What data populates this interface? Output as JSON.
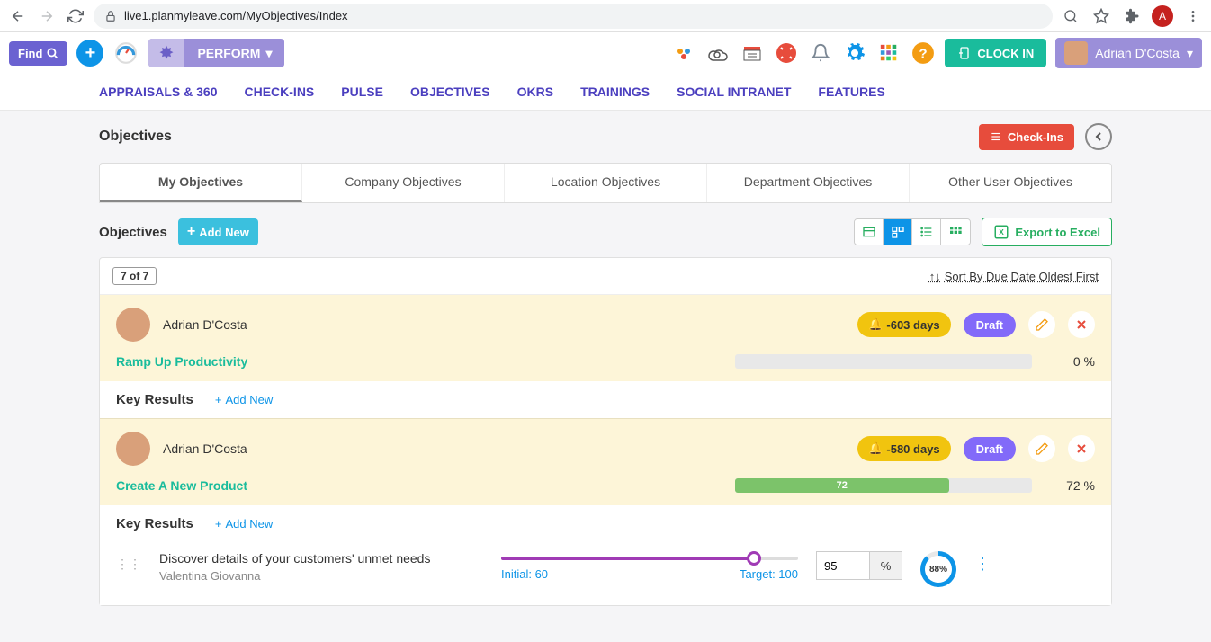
{
  "browser": {
    "url": "live1.planmyleave.com/MyObjectives/Index",
    "avatar_letter": "A"
  },
  "app_bar": {
    "find_label": "Find",
    "perform_label": "PERFORM",
    "clock_in_label": "CLOCK IN",
    "user_name": "Adrian D'Costa"
  },
  "nav": [
    "APPRAISALS & 360",
    "CHECK-INS",
    "PULSE",
    "OBJECTIVES",
    "OKRS",
    "TRAININGS",
    "SOCIAL INTRANET",
    "FEATURES"
  ],
  "page": {
    "title": "Objectives",
    "checkins_btn": "Check-Ins"
  },
  "subtabs": [
    "My Objectives",
    "Company Objectives",
    "Location Objectives",
    "Department Objectives",
    "Other User Objectives"
  ],
  "toolbar": {
    "title": "Objectives",
    "add_new": "Add New",
    "export": "Export to Excel"
  },
  "list": {
    "count": "7 of 7",
    "sort_label": "Sort By Due Date Oldest First"
  },
  "objectives": [
    {
      "user": "Adrian D'Costa",
      "days": "-603 days",
      "status": "Draft",
      "name": "Ramp Up Productivity",
      "progress_pct": 0,
      "progress_label": "0 %",
      "kr_header": "Key Results",
      "kr_add": "Add New"
    },
    {
      "user": "Adrian D'Costa",
      "days": "-580 days",
      "status": "Draft",
      "name": "Create A New Product",
      "progress_pct": 72,
      "progress_fill_text": "72",
      "progress_label": "72 %",
      "kr_header": "Key Results",
      "kr_add": "Add New",
      "key_results": [
        {
          "desc": "Discover details of your customers' unmet needs",
          "owner": "Valentina Giovanna",
          "initial_label": "Initial: 60",
          "target_label": "Target: 100",
          "slider_pct": 85,
          "value": "95",
          "unit": "%",
          "donut_pct": 88,
          "donut_label": "88%"
        }
      ]
    }
  ]
}
